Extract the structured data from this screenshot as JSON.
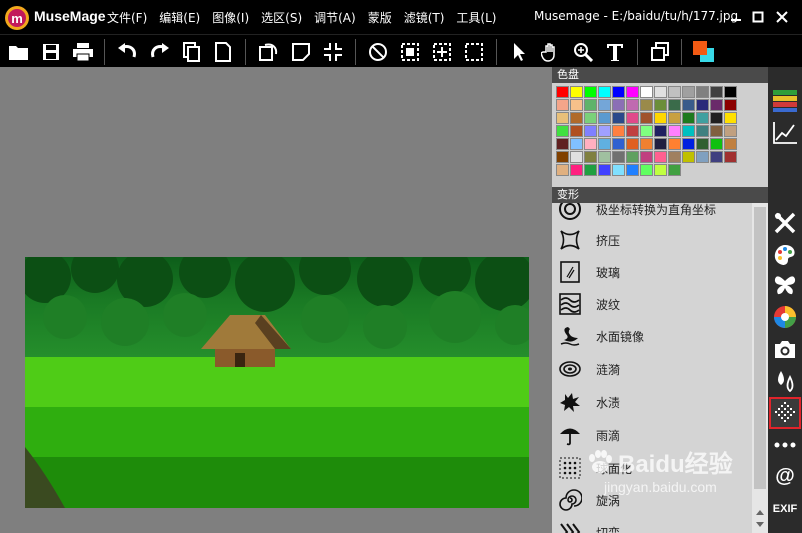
{
  "app": {
    "name": "MuseMage",
    "doc_title": "Musemage - E:/baidu/tu/h/177.jpg"
  },
  "menu": [
    "文件(F)",
    "编辑(E)",
    "图像(I)",
    "选区(S)",
    "调节(A)",
    "蒙版",
    "滤镜(T)",
    "工具(L)"
  ],
  "toolbar": {
    "icons": [
      "open-folder-icon",
      "save-icon",
      "print-icon",
      "undo-icon",
      "redo-icon",
      "copy-icon",
      "new-document-icon",
      "rotate-icon",
      "crop-icon",
      "resize-icon",
      "no-select-icon",
      "select-rect-icon",
      "select-center-icon",
      "select-dashed-icon",
      "pointer-icon",
      "hand-icon",
      "zoom-icon",
      "text-icon",
      "layers-icon",
      "color-icon"
    ]
  },
  "palette": {
    "title": "色盘",
    "colors": [
      "#ff0000",
      "#ffff00",
      "#00ff00",
      "#00ffff",
      "#0000ff",
      "#ff00ff",
      "#ffffff",
      "#e0e0e0",
      "#c0c0c0",
      "#a0a0a0",
      "#808080",
      "#404040",
      "#000000",
      "#f4a58a",
      "#f7c08a",
      "#5fb36a",
      "#74a6d8",
      "#8b6fb5",
      "#c06ab0",
      "#9a8a4a",
      "#6b8e3a",
      "#3a6b4a",
      "#3a5b8b",
      "#2a2a7a",
      "#6a2a6a",
      "#8b0000",
      "#e8c07a",
      "#b06a2a",
      "#7ad07a",
      "#5a9ad0",
      "#2a4a8a",
      "#e04a8a",
      "#a0522d",
      "#ffd700",
      "#c8a040",
      "#1e7a1e",
      "#40a0a0",
      "#202020",
      "#ffe000",
      "#40e040",
      "#b05020",
      "#8080ff",
      "#a0a0ff",
      "#ff8040",
      "#c04040",
      "#80ff80",
      "#202060",
      "#ff80ff",
      "#00c0c0",
      "#408080",
      "#806040",
      "#c0a080",
      "#602020",
      "#80c0ff",
      "#ffb0c0",
      "#60b0e0",
      "#3060d0",
      "#e06020",
      "#f08030",
      "#202040",
      "#ff8030",
      "#0020e0",
      "#306030",
      "#10c010",
      "#c08040",
      "#804000",
      "#e0e0e0",
      "#808040",
      "#a0c0a0",
      "#707070",
      "#60a060",
      "#c04080",
      "#ff6090",
      "#a08060",
      "#c0c000",
      "#80a0c0",
      "#404080",
      "#a03030",
      "#e0b080",
      "#ff2080",
      "#20a040",
      "#4040ff",
      "#80e0ff",
      "#2080ff",
      "#60ff60",
      "#c0ff40",
      "#40a040"
    ]
  },
  "effects_panel": {
    "title": "变形",
    "items": [
      {
        "label": "极坐标转换为直角坐标",
        "icon": "polar-icon"
      },
      {
        "label": "挤压",
        "icon": "squeeze-icon"
      },
      {
        "label": "玻璃",
        "icon": "glass-icon"
      },
      {
        "label": "波纹",
        "icon": "wave-icon"
      },
      {
        "label": "水面镜像",
        "icon": "swan-icon"
      },
      {
        "label": "涟漪",
        "icon": "ripple-icon"
      },
      {
        "label": "水渍",
        "icon": "splash-icon"
      },
      {
        "label": "雨滴",
        "icon": "umbrella-icon"
      },
      {
        "label": "球面化",
        "icon": "sphere-icon"
      },
      {
        "label": "旋涡",
        "icon": "swirl-icon"
      },
      {
        "label": "切变",
        "icon": "shear-icon"
      }
    ]
  },
  "right_strip": {
    "icons": [
      "histogram-icon",
      "curve-icon",
      "tools-icon",
      "palette-icon",
      "butterfly-icon",
      "color-wheel-icon",
      "camera-icon",
      "drops-icon",
      "distort-icon",
      "more-icon",
      "at-icon",
      "exif-icon"
    ],
    "active": "distort-icon",
    "exif_label": "EXIF"
  },
  "watermark": {
    "text": "Baidu经验",
    "sub": "jingyan.baidu.com"
  }
}
